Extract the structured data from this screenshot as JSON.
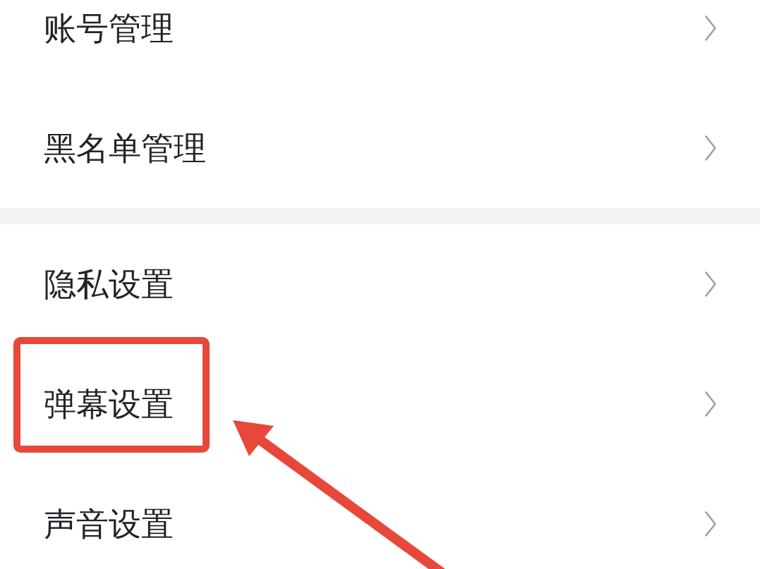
{
  "settings_groups": [
    {
      "items": [
        {
          "label": "账号管理",
          "highlighted": false
        },
        {
          "label": "黑名单管理",
          "highlighted": false
        }
      ]
    },
    {
      "items": [
        {
          "label": "隐私设置",
          "highlighted": false
        },
        {
          "label": "弹幕设置",
          "highlighted": true
        },
        {
          "label": "声音设置",
          "highlighted": false
        }
      ]
    }
  ]
}
